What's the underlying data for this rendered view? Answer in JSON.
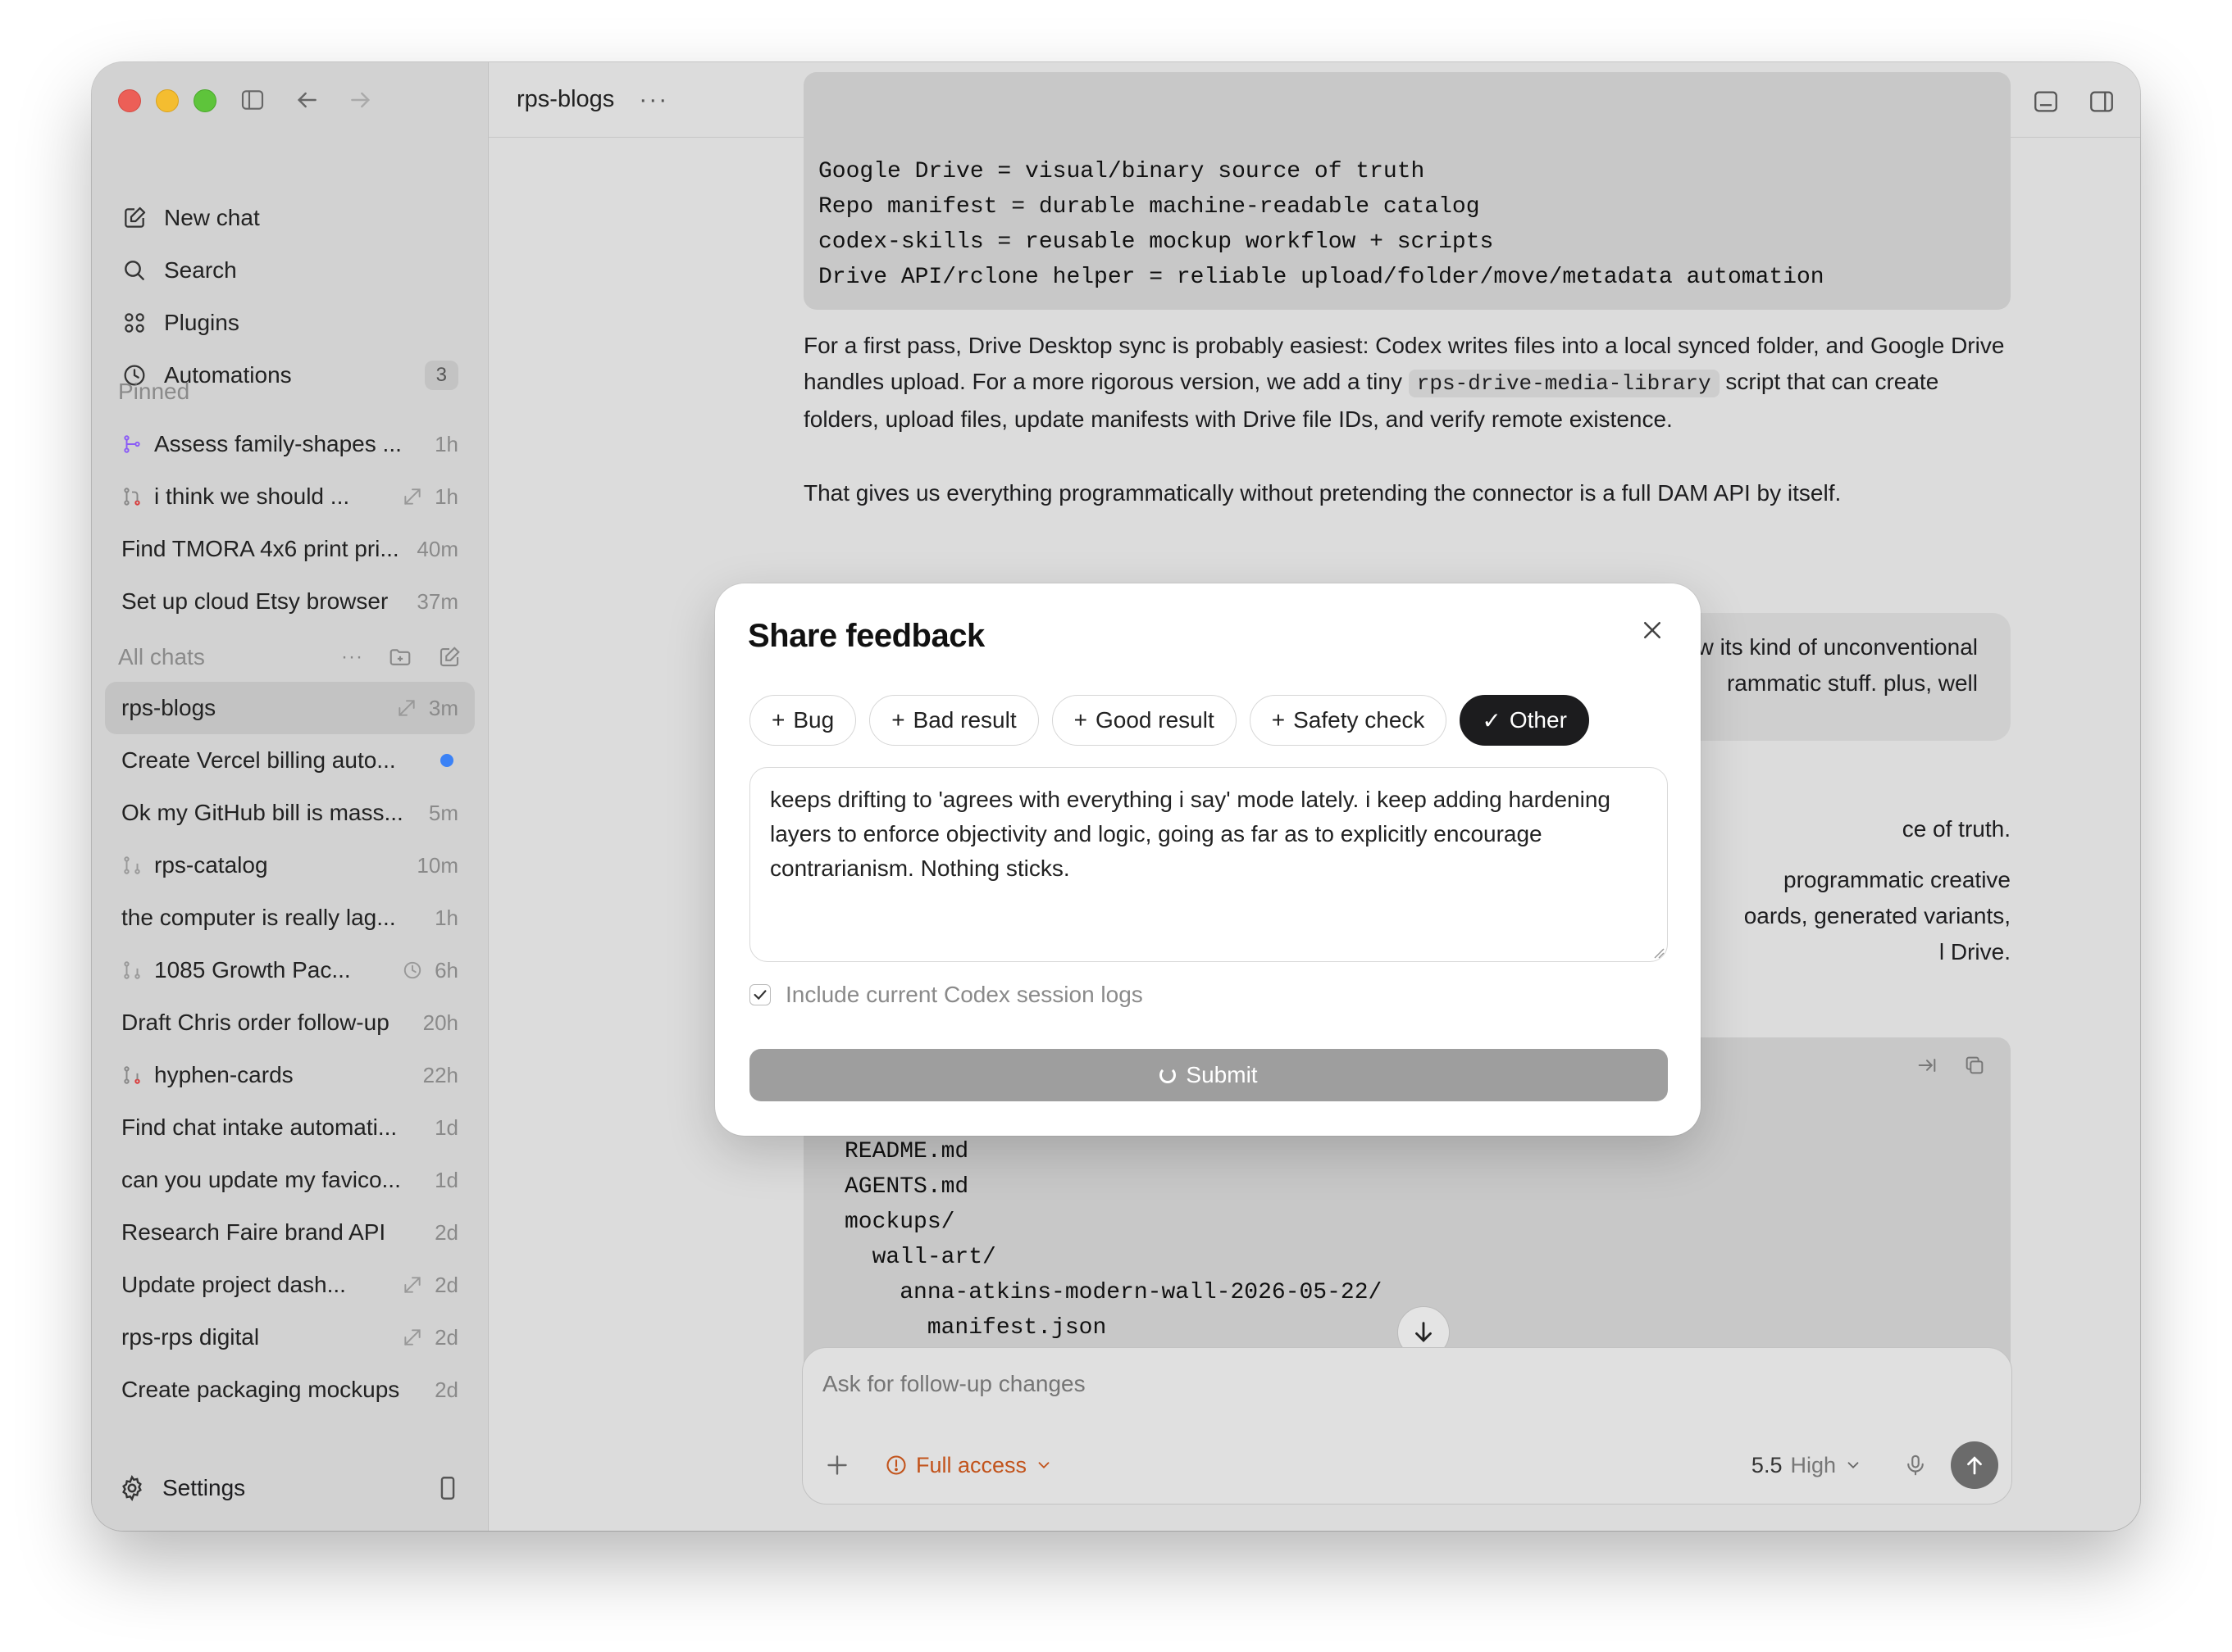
{
  "sidebar": {
    "nav": [
      {
        "label": "New chat",
        "icon": "new-chat-icon"
      },
      {
        "label": "Search",
        "icon": "search-icon"
      },
      {
        "label": "Plugins",
        "icon": "plugins-icon"
      },
      {
        "label": "Automations",
        "icon": "clock-icon",
        "badge": "3"
      }
    ],
    "pinned_label": "Pinned",
    "pinned": [
      {
        "title": "Assess family-shapes ...",
        "time": "1h"
      },
      {
        "title": "i think we should ...",
        "time": "1h"
      },
      {
        "title": "Find TMORA 4x6 print pri...",
        "time": "40m"
      },
      {
        "title": "Set up cloud Etsy browser",
        "time": "37m"
      }
    ],
    "all_chats_label": "All chats",
    "all_chats_more": "···",
    "chats": [
      {
        "title": "rps-blogs",
        "time": "3m"
      },
      {
        "title": "Create Vercel billing auto...",
        "time": ""
      },
      {
        "title": "Ok my GitHub bill is mass...",
        "time": "5m"
      },
      {
        "title": "rps-catalog",
        "time": "10m"
      },
      {
        "title": "the computer is really lag...",
        "time": "1h"
      },
      {
        "title": "1085 Growth Pac...",
        "time": "6h"
      },
      {
        "title": "Draft Chris order follow-up",
        "time": "20h"
      },
      {
        "title": "hyphen-cards",
        "time": "22h"
      },
      {
        "title": "Find chat intake automati...",
        "time": "1d"
      },
      {
        "title": "can you update my favico...",
        "time": "1d"
      },
      {
        "title": "Research Faire brand API",
        "time": "2d"
      },
      {
        "title": "Update project dash...",
        "time": "2d"
      },
      {
        "title": "rps-rps digital",
        "time": "2d"
      },
      {
        "title": "Create packaging mockups",
        "time": "2d"
      }
    ],
    "settings_label": "Settings"
  },
  "header": {
    "title": "rps-blogs",
    "more": "···"
  },
  "conversation": {
    "code1": "Google Drive = visual/binary source of truth\nRepo manifest = durable machine-readable catalog\ncodex-skills = reusable mockup workflow + scripts\nDrive API/rclone helper = reliable upload/folder/move/metadata automation",
    "para1_a": "For a first pass, Drive Desktop sync is probably easiest: Codex writes files into a local synced folder, and Google Drive handles upload. For a more rigorous version, we add a tiny ",
    "para1_code": "rps-drive-media-library",
    "para1_b": " script that can create folders, upload files, update manifests with Drive file IDs, and verify remote existence.",
    "para2": "That gives us everything programmatically without pretending the connector is a full DAM API by itself.",
    "bubble_line1": "w its kind of unconventional",
    "bubble_line2": "rammatic stuff. plus, well",
    "partial1": "ce of truth.",
    "partial2_l1": "programmatic creative",
    "partial2_l2": "oards, generated variants,",
    "partial2_l3": "l Drive.",
    "code2": "README.md\nAGENTS.md\nmockups/\n  wall-art/\n    anna-atkins-modern-wall-2026-05-22/\n      manifest.json\n      raw-bases/\n      composited-examples/"
  },
  "composer": {
    "placeholder": "Ask for follow-up changes",
    "access_label": "Full access",
    "model_version": "5.5",
    "model_effort": "High"
  },
  "modal": {
    "title": "Share feedback",
    "chips": [
      {
        "label": "Bug",
        "active": false
      },
      {
        "label": "Bad result",
        "active": false
      },
      {
        "label": "Good result",
        "active": false
      },
      {
        "label": "Safety check",
        "active": false
      },
      {
        "label": "Other",
        "active": true
      }
    ],
    "feedback_text": "keeps drifting to 'agrees with everything i say' mode lately. i keep adding hardening layers to enforce objectivity and logic, going as far as to explicitly encourage contrarianism. Nothing sticks.",
    "include_logs_label": "Include current Codex session logs",
    "include_logs_checked": true,
    "submit_label": "Submit"
  }
}
